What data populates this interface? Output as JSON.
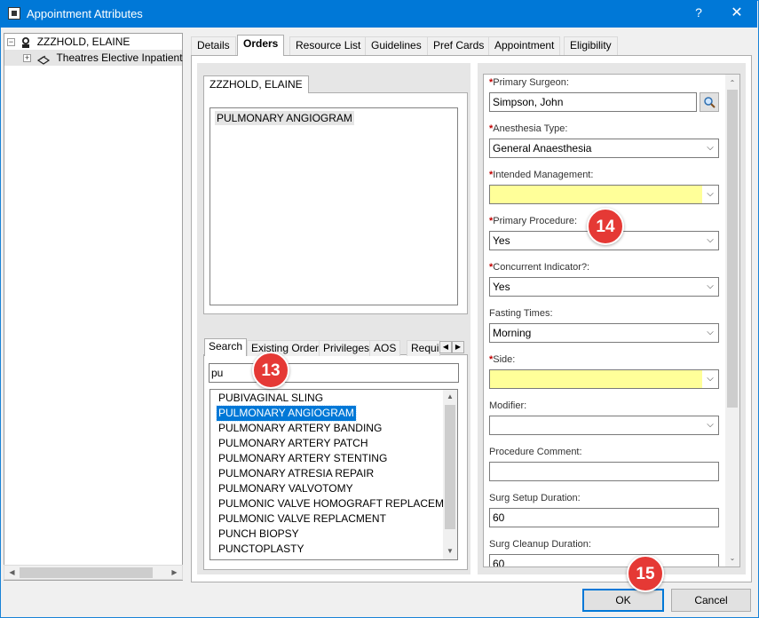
{
  "window": {
    "title": "Appointment Attributes",
    "help_glyph": "?",
    "close_glyph": "✕"
  },
  "tree": {
    "root": {
      "expander": "−",
      "label": "ZZZHOLD, ELAINE"
    },
    "child": {
      "expander": "+",
      "label": "Theatres Elective Inpatient"
    }
  },
  "tabs": [
    "Details",
    "Orders",
    "Resource List",
    "Guidelines",
    "Pref Cards",
    "Appointment",
    "Eligibility"
  ],
  "active_tab": "Orders",
  "orders": {
    "patient_tab": "ZZZHOLD, ELAINE",
    "selected_order": "PULMONARY ANGIOGRAM"
  },
  "search": {
    "tabs": [
      "Search",
      "Existing Orders",
      "Privileges",
      "AOS",
      "Requi"
    ],
    "query": "pu",
    "results": [
      "PUBIVAGINAL SLING",
      "PULMONARY ANGIOGRAM",
      "PULMONARY ARTERY BANDING",
      "PULMONARY ARTERY PATCH",
      "PULMONARY ARTERY STENTING",
      "PULMONARY ATRESIA REPAIR",
      "PULMONARY VALVOTOMY",
      "PULMONIC VALVE HOMOGRAFT REPLACEMENT",
      "PULMONIC VALVE REPLACMENT",
      "PUNCH BIOPSY",
      "PUNCTOPLASTY"
    ],
    "selected_result": "PULMONARY ANGIOGRAM"
  },
  "form": {
    "fields": [
      {
        "label": "Primary Surgeon:",
        "required": true,
        "value": "Simpson, John",
        "type": "lookup",
        "highlight": false
      },
      {
        "label": "Anesthesia Type:",
        "required": true,
        "value": "General Anaesthesia",
        "type": "dropdown",
        "highlight": false
      },
      {
        "label": "Intended Management:",
        "required": true,
        "value": "",
        "type": "dropdown",
        "highlight": true
      },
      {
        "label": "Primary Procedure:",
        "required": true,
        "value": "Yes",
        "type": "dropdown",
        "highlight": false
      },
      {
        "label": "Concurrent Indicator?:",
        "required": true,
        "value": "Yes",
        "type": "dropdown",
        "highlight": false
      },
      {
        "label": "Fasting Times:",
        "required": false,
        "value": "Morning",
        "type": "dropdown",
        "highlight": false
      },
      {
        "label": "Side:",
        "required": true,
        "value": "",
        "type": "dropdown",
        "highlight": true
      },
      {
        "label": "Modifier:",
        "required": false,
        "value": "",
        "type": "dropdown",
        "highlight": false
      },
      {
        "label": "Procedure Comment:",
        "required": false,
        "value": "",
        "type": "text",
        "highlight": false
      },
      {
        "label": "Surg Setup Duration:",
        "required": false,
        "value": "60",
        "type": "text",
        "highlight": false
      },
      {
        "label": "Surg Cleanup Duration:",
        "required": false,
        "value": "60",
        "type": "text",
        "highlight": false
      }
    ],
    "required_marker": "*"
  },
  "buttons": {
    "ok": "OK",
    "cancel": "Cancel"
  },
  "callouts": [
    "13",
    "14",
    "15"
  ],
  "colors": {
    "titlebar": "#0078d7",
    "required_highlight": "#ffff99",
    "selection": "#0078d7",
    "callout": "#e53935"
  }
}
